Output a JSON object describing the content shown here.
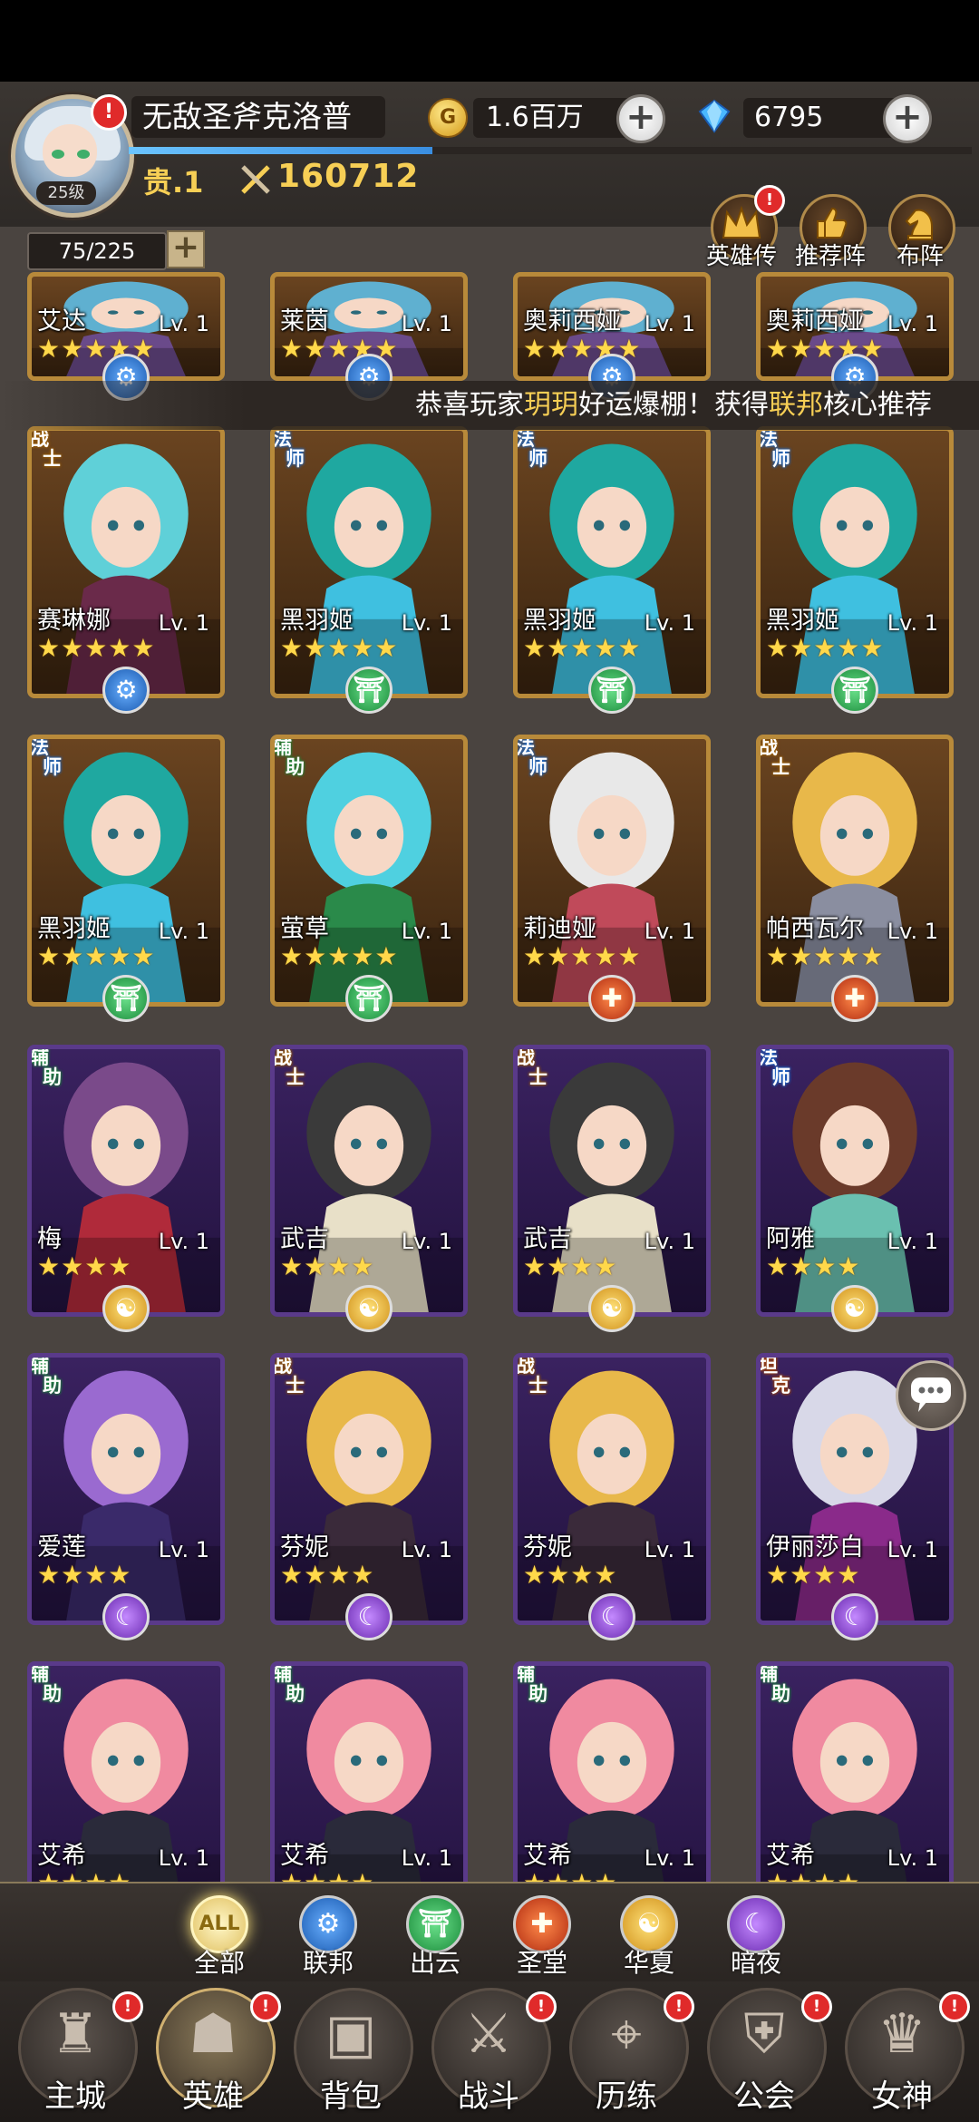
{
  "player": {
    "level_label": "25级",
    "name": "无敌圣斧克洛普",
    "gold": "1.6百万",
    "gold_icon_letter": "G",
    "diamonds": "6795",
    "rank": "贵.1",
    "power": "160712",
    "hero_count": "75/225",
    "xp_fraction": 0.36
  },
  "top_buttons": [
    {
      "label": "英雄传",
      "icon": "crown-icon",
      "badge": "!"
    },
    {
      "label": "推荐阵",
      "icon": "thumbs-up-icon"
    },
    {
      "label": "布阵",
      "icon": "chess-knight-icon"
    }
  ],
  "ticker": {
    "part1": "恭喜玩家",
    "player": "玥玥",
    "part2": "好运爆棚！获得",
    "faction": "联邦",
    "part3": "核心推荐"
  },
  "partial_row": [
    {
      "name": "艾达",
      "lv": "Lv. 1",
      "stars": 5
    },
    {
      "name": "莱茵",
      "lv": "Lv. 1",
      "stars": 5
    },
    {
      "name": "奥莉西娅",
      "lv": "Lv. 1",
      "stars": 5
    },
    {
      "name": "奥莉西娅",
      "lv": "Lv. 1",
      "stars": 5
    }
  ],
  "heroes": [
    {
      "name": "赛琳娜",
      "lv": "Lv. 1",
      "stars": 5,
      "role": "战士",
      "faction": "联邦",
      "tier": "gold",
      "hair": "#5fd0d8",
      "outfit": "#6a2a4a"
    },
    {
      "name": "黑羽姬",
      "lv": "Lv. 1",
      "stars": 5,
      "role": "法师",
      "faction": "出云",
      "tier": "gold",
      "hair": "#1fa8a0",
      "outfit": "#3fc0e0"
    },
    {
      "name": "黑羽姬",
      "lv": "Lv. 1",
      "stars": 5,
      "role": "法师",
      "faction": "出云",
      "tier": "gold",
      "hair": "#1fa8a0",
      "outfit": "#3fc0e0"
    },
    {
      "name": "黑羽姬",
      "lv": "Lv. 1",
      "stars": 5,
      "role": "法师",
      "faction": "出云",
      "tier": "gold",
      "hair": "#1fa8a0",
      "outfit": "#3fc0e0"
    },
    {
      "name": "黑羽姬",
      "lv": "Lv. 1",
      "stars": 5,
      "role": "法师",
      "faction": "出云",
      "tier": "gold",
      "hair": "#1fa8a0",
      "outfit": "#3fc0e0"
    },
    {
      "name": "萤草",
      "lv": "Lv. 1",
      "stars": 5,
      "role": "辅助",
      "faction": "出云",
      "tier": "gold",
      "hair": "#4fd0e0",
      "outfit": "#2a8a4a"
    },
    {
      "name": "莉迪娅",
      "lv": "Lv. 1",
      "stars": 5,
      "role": "法师",
      "faction": "圣堂",
      "tier": "gold",
      "hair": "#e8e8e8",
      "outfit": "#c04a5a"
    },
    {
      "name": "帕西瓦尔",
      "lv": "Lv. 1",
      "stars": 5,
      "role": "战士",
      "faction": "圣堂",
      "tier": "gold",
      "hair": "#e8b84a",
      "outfit": "#8a8ea0"
    },
    {
      "name": "梅",
      "lv": "Lv. 1",
      "stars": 4,
      "role": "辅助",
      "faction": "华夏",
      "tier": "purple",
      "hair": "#7a4a8a",
      "outfit": "#b02a3a"
    },
    {
      "name": "武吉",
      "lv": "Lv. 1",
      "stars": 4,
      "role": "战士",
      "faction": "华夏",
      "tier": "purple",
      "hair": "#3a3a3a",
      "outfit": "#e8e0c8"
    },
    {
      "name": "武吉",
      "lv": "Lv. 1",
      "stars": 4,
      "role": "战士",
      "faction": "华夏",
      "tier": "purple",
      "hair": "#3a3a3a",
      "outfit": "#e8e0c8"
    },
    {
      "name": "阿雅",
      "lv": "Lv. 1",
      "stars": 4,
      "role": "法师",
      "faction": "华夏",
      "tier": "purple",
      "hair": "#6a3a2a",
      "outfit": "#6ac0b0"
    },
    {
      "name": "爱莲",
      "lv": "Lv. 1",
      "stars": 4,
      "role": "辅助",
      "faction": "暗夜",
      "tier": "purple",
      "hair": "#9a6ad0",
      "outfit": "#3a2a6a"
    },
    {
      "name": "芬妮",
      "lv": "Lv. 1",
      "stars": 4,
      "role": "战士",
      "faction": "暗夜",
      "tier": "purple",
      "hair": "#e8b84a",
      "outfit": "#3a2a3a"
    },
    {
      "name": "芬妮",
      "lv": "Lv. 1",
      "stars": 4,
      "role": "战士",
      "faction": "暗夜",
      "tier": "purple",
      "hair": "#e8b84a",
      "outfit": "#3a2a3a"
    },
    {
      "name": "伊丽莎白",
      "lv": "Lv. 1",
      "stars": 4,
      "role": "坦克",
      "faction": "暗夜",
      "tier": "purple",
      "hair": "#d8d8e8",
      "outfit": "#8a2a8a"
    },
    {
      "name": "艾希",
      "lv": "Lv. 1",
      "stars": 4,
      "role": "辅助",
      "faction": "暗夜",
      "tier": "purple",
      "hair": "#f08aa0",
      "outfit": "#2a2a3a"
    },
    {
      "name": "艾希",
      "lv": "Lv. 1",
      "stars": 4,
      "role": "辅助",
      "faction": "暗夜",
      "tier": "purple",
      "hair": "#f08aa0",
      "outfit": "#2a2a3a"
    },
    {
      "name": "艾希",
      "lv": "Lv. 1",
      "stars": 4,
      "role": "辅助",
      "faction": "暗夜",
      "tier": "purple",
      "hair": "#f08aa0",
      "outfit": "#2a2a3a"
    },
    {
      "name": "艾希",
      "lv": "Lv. 1",
      "stars": 4,
      "role": "辅助",
      "faction": "暗夜",
      "tier": "purple",
      "hair": "#f08aa0",
      "outfit": "#2a2a3a"
    }
  ],
  "filters": [
    {
      "label": "全部",
      "icon": "ALL",
      "key": "all",
      "active": true
    },
    {
      "label": "联邦",
      "icon": "⚙",
      "key": "lianbang"
    },
    {
      "label": "出云",
      "icon": "⛩",
      "key": "chuyun"
    },
    {
      "label": "圣堂",
      "icon": "✚",
      "key": "shengtang"
    },
    {
      "label": "华夏",
      "icon": "☯",
      "key": "huaxia"
    },
    {
      "label": "暗夜",
      "icon": "☾",
      "key": "anye"
    }
  ],
  "nav": [
    {
      "label": "主城",
      "icon": "castle-icon",
      "badge": "!"
    },
    {
      "label": "英雄",
      "icon": "hero-hood-icon",
      "badge": "!",
      "active": true
    },
    {
      "label": "背包",
      "icon": "backpack-icon"
    },
    {
      "label": "战斗",
      "icon": "crossed-swords-icon",
      "badge": "!"
    },
    {
      "label": "历练",
      "icon": "map-icon",
      "badge": "!"
    },
    {
      "label": "公会",
      "icon": "guild-shield-icon",
      "badge": "!"
    },
    {
      "label": "女神",
      "icon": "goddess-icon",
      "badge": "!"
    }
  ],
  "colors": {
    "gold_text": "#f7cf55",
    "star": "#ffd84a",
    "gold_frame": "#b88a3a",
    "purple_frame": "#5a3a8a"
  }
}
